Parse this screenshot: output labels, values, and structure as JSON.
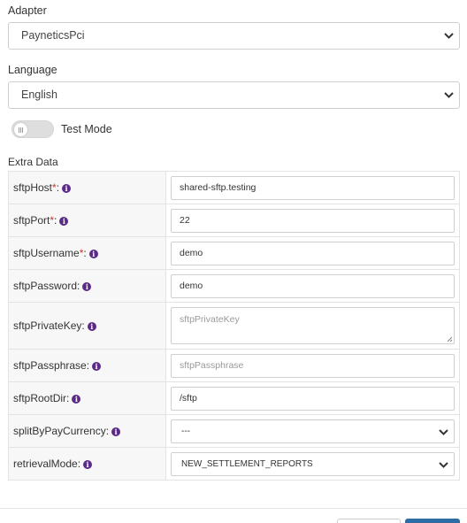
{
  "adapter": {
    "label": "Adapter",
    "value": "PayneticsPci"
  },
  "language": {
    "label": "Language",
    "value": "English"
  },
  "test_mode": {
    "label": "Test Mode",
    "enabled": false
  },
  "extra_data": {
    "label": "Extra Data",
    "required_marker": "*",
    "fields": [
      {
        "key": "sftpHost",
        "required": true,
        "value": "shared-sftp.testing",
        "placeholder": "",
        "kind": "input"
      },
      {
        "key": "sftpPort",
        "required": true,
        "value": "22",
        "placeholder": "",
        "kind": "input"
      },
      {
        "key": "sftpUsername",
        "required": true,
        "value": "demo",
        "placeholder": "",
        "kind": "input"
      },
      {
        "key": "sftpPassword",
        "required": false,
        "value": "demo",
        "placeholder": "",
        "kind": "input"
      },
      {
        "key": "sftpPrivateKey",
        "required": false,
        "value": "",
        "placeholder": "sftpPrivateKey",
        "kind": "textarea"
      },
      {
        "key": "sftpPassphrase",
        "required": false,
        "value": "",
        "placeholder": "sftpPassphrase",
        "kind": "input"
      },
      {
        "key": "sftpRootDir",
        "required": false,
        "value": "/sftp",
        "placeholder": "",
        "kind": "input"
      },
      {
        "key": "splitByPayCurrency",
        "required": false,
        "value": "---",
        "placeholder": "",
        "kind": "select"
      },
      {
        "key": "retrievalMode",
        "required": false,
        "value": "NEW_SETTLEMENT_REPORTS",
        "placeholder": "",
        "kind": "select"
      }
    ]
  },
  "icons": {
    "info": "info-circle-icon",
    "chevron": "chevron-down-icon",
    "toggle": "toggle-switch"
  },
  "colors": {
    "info_icon": "#5b2a86",
    "required": "#c0392b",
    "primary_button": "#2e6da4"
  }
}
